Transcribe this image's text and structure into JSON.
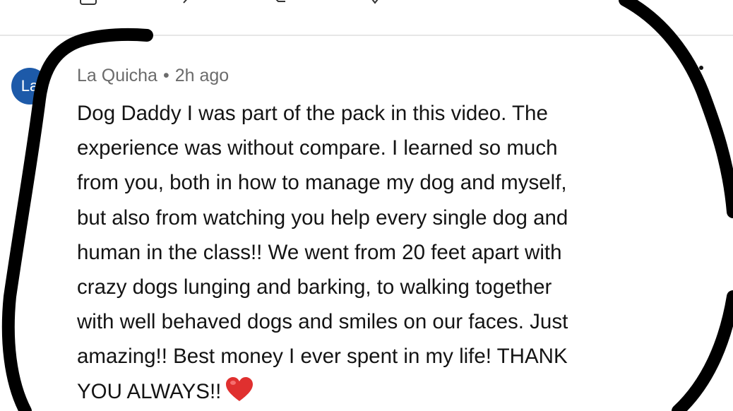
{
  "comment": {
    "avatar_initials": "La",
    "author": "La Quicha",
    "separator": "•",
    "timestamp": "2h ago",
    "body_lines": [
      "Dog Daddy I was part of the pack in this video. The",
      "experience was without compare. I learned so much",
      "from you, both in how to manage my dog and myself,",
      "but also from watching you help every single dog and",
      "human in the class!! We went from 20 feet apart with",
      "crazy dogs lunging and barking, to walking together",
      "with well behaved dogs and smiles on our faces. Just",
      "amazing!! Best money I ever spent in my life! THANK",
      "YOU ALWAYS!!"
    ],
    "emoji": "heart-icon"
  },
  "icons": {
    "more_options": "more-vertical-icon",
    "top_actions": [
      "share-icon",
      "like-icon",
      "comment-icon",
      "save-icon"
    ]
  },
  "colors": {
    "avatar_bg": "#1d5aa9",
    "meta_text": "#6b6b6b",
    "body_text": "#141414",
    "heart": "#e0302f",
    "annotation_ink": "#000000"
  }
}
